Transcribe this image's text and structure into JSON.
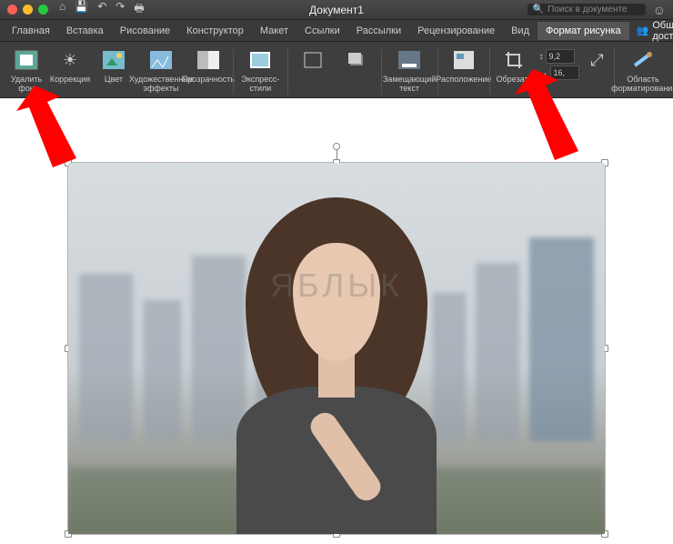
{
  "titlebar": {
    "document_title": "Документ1",
    "search_placeholder": "Поиск в документе"
  },
  "tabs": {
    "items": [
      {
        "label": "Главная"
      },
      {
        "label": "Вставка"
      },
      {
        "label": "Рисование"
      },
      {
        "label": "Конструктор"
      },
      {
        "label": "Макет"
      },
      {
        "label": "Ссылки"
      },
      {
        "label": "Рассылки"
      },
      {
        "label": "Рецензирование"
      },
      {
        "label": "Вид"
      },
      {
        "label": "Формат рисунка"
      }
    ],
    "active_index": 9,
    "share_label": "Общий доступ"
  },
  "ribbon": {
    "remove_bg": "Удалить фон",
    "corrections": "Коррекция",
    "color": "Цвет",
    "artistic": "Художественные эффекты",
    "transparency": "Прозрачность",
    "quick_styles": "Экспресс-стили",
    "alt_text": "Замещающий текст",
    "position": "Расположение",
    "crop": "Обрезать",
    "height_value": "9,2",
    "width_value": "16,",
    "format_pane": "Область форматирования"
  },
  "watermark": "ЯБЛЫК",
  "colors": {
    "arrow": "#ff0000"
  }
}
